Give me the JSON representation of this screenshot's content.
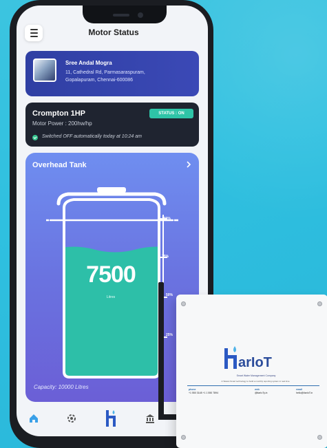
{
  "header": {
    "title": "Motor Status",
    "menu_icon": "hamburger-icon"
  },
  "location": {
    "name": "Sree Andal Mogra",
    "address_line1": "11, Cathedral Rd, Parmasaraspuram,",
    "address_line2": "Gopalapuram, Chennai-600086"
  },
  "motor": {
    "name": "Crompton 1HP",
    "power": "Motor Power : 200hw/hp",
    "status_badge": "STATUS : ON",
    "note": "Switched OFF automatically today at 10:24 am"
  },
  "tank": {
    "title": "Overhead Tank",
    "volume": "7500",
    "unit": "Litres",
    "capacity": "Capacity: 10000 Litres",
    "level_fraction": 0.75,
    "markers": [
      "100%",
      "75%",
      "50%",
      "25%"
    ]
  },
  "nav": {
    "items": [
      "home-icon",
      "settings-icon",
      "logo-icon",
      "bank-icon",
      "profile-icon"
    ]
  },
  "device": {
    "brand": "arIoT",
    "tagline": "Smart Water Management Company",
    "subtext": "A Taiwan Smart technology to build a monthly reporting system in real time",
    "contacts": [
      {
        "label": "phone",
        "value": "+1 550 3148 +1 1 550 7894"
      },
      {
        "label": "web",
        "value": "@tiarIoTy.in"
      },
      {
        "label": "email",
        "value": "hello@tiarIoT.in"
      }
    ]
  },
  "colors": {
    "accent": "#2ec4a7",
    "card_blue": "#3342aa",
    "motor_card": "#1f2430",
    "tank_top": "#6f8ef0",
    "water": "#2dbfa8",
    "background": "#31c1e0"
  }
}
